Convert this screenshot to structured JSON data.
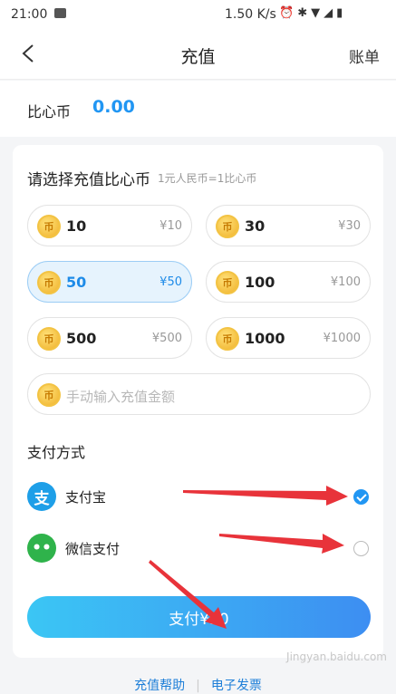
{
  "status_bar": {
    "time": "21:00",
    "speed": "1.50 K/s"
  },
  "nav": {
    "back_icon": "chevron-left-icon",
    "title": "充值",
    "bill": "账单"
  },
  "balance": {
    "label": "比心币",
    "value": "0.00"
  },
  "recharge": {
    "title": "请选择充值比心币",
    "hint": "1元人民币=1比心币",
    "coin_glyph": "币",
    "options": [
      {
        "amount": "10",
        "price": "¥10"
      },
      {
        "amount": "30",
        "price": "¥30"
      },
      {
        "amount": "50",
        "price": "¥50"
      },
      {
        "amount": "100",
        "price": "¥100"
      },
      {
        "amount": "500",
        "price": "¥500"
      },
      {
        "amount": "1000",
        "price": "¥1000"
      }
    ],
    "selected_amount": "50",
    "custom_placeholder": "手动输入充值金额"
  },
  "payment": {
    "title": "支付方式",
    "methods": [
      {
        "label": "支付宝",
        "icon": "alipay-icon",
        "icon_glyph": "支",
        "checked": true
      },
      {
        "label": "微信支付",
        "icon": "wechat-icon",
        "icon_glyph": "••",
        "checked": false
      }
    ],
    "pay_button": "支付¥50"
  },
  "footer": {
    "help": "充值帮助",
    "invoice": "电子发票"
  },
  "watermark": "Jingyan.baidu.com",
  "colors": {
    "accent": "#2196f3",
    "alipay": "#1e9fe8",
    "wechat": "#2fb34b",
    "annotation_arrow": "#e8333a"
  }
}
